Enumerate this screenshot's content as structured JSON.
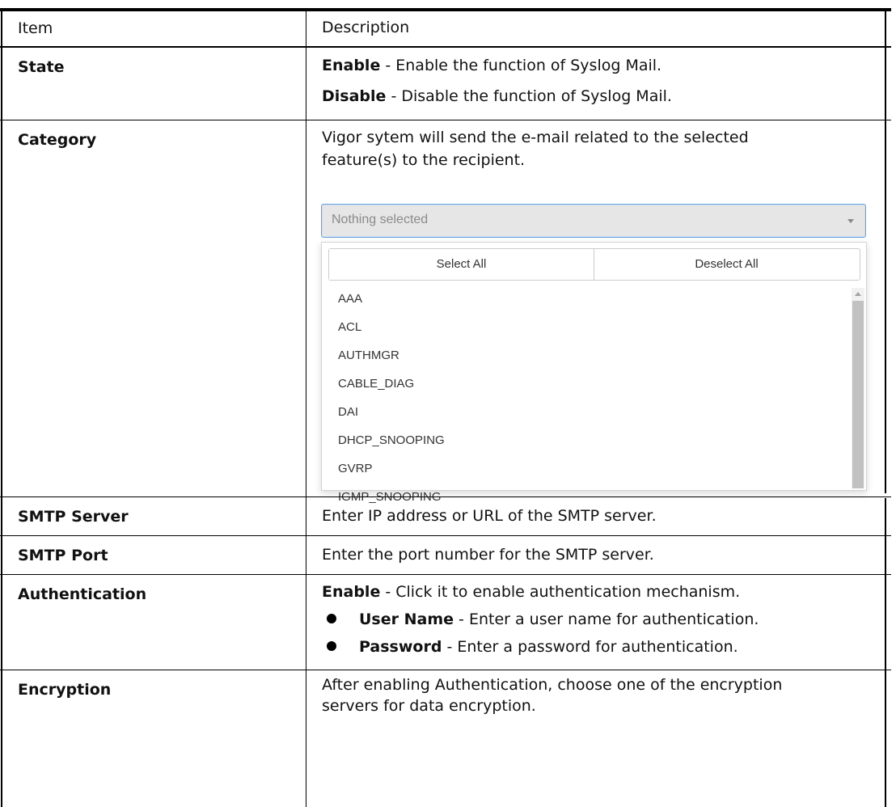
{
  "header": {
    "item": "Item",
    "description": "Description"
  },
  "rows": {
    "state": {
      "item": "State",
      "enable_term": "Enable",
      "enable_text": " - Enable the function of Syslog Mail.",
      "disable_term": "Disable",
      "disable_text": " - Disable the function of Syslog Mail."
    },
    "category": {
      "item": "Category",
      "line1": "Vigor sytem will send the e-mail related to the selected",
      "line2": "feature(s) to the recipient."
    },
    "smtp_server": {
      "item": "SMTP Server",
      "text": "Enter IP address or URL of the SMTP server."
    },
    "smtp_port": {
      "item": "SMTP Port",
      "text": "Enter the port number for the SMTP server."
    },
    "authentication": {
      "item": "Authentication",
      "enable_term": "Enable",
      "enable_text": " - Click it to enable authentication mechanism.",
      "user_term": "User Name",
      "user_text": " - Enter a user name for authentication.",
      "pass_term": "Password",
      "pass_text": " - Enter a password for authentication."
    },
    "encryption": {
      "item": "Encryption",
      "line1": "After enabling Authentication, choose one of the encryption",
      "line2": "servers for data encryption."
    }
  },
  "dropdown": {
    "placeholder": "Nothing selected",
    "select_all": "Select All",
    "deselect_all": "Deselect All",
    "options": [
      "AAA",
      "ACL",
      "AUTHMGR",
      "CABLE_DIAG",
      "DAI",
      "DHCP_SNOOPING",
      "GVRP",
      "IGMP_SNOOPING"
    ]
  }
}
